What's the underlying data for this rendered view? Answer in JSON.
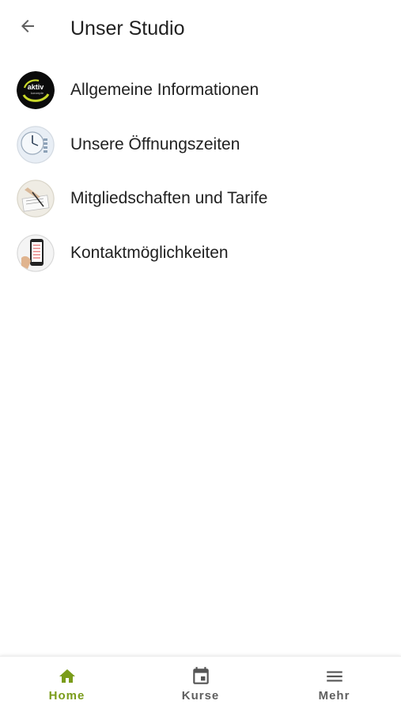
{
  "colors": {
    "accent": "#7a9c1a",
    "inactive": "#555555",
    "text": "#212121",
    "background": "#ffffff"
  },
  "header": {
    "back_icon": "arrow-back-icon",
    "title": "Unser Studio"
  },
  "menu": {
    "items": [
      {
        "label": "Allgemeine Informationen",
        "icon": "aktiv-konzepte-logo"
      },
      {
        "label": "Unsere Öffnungszeiten",
        "icon": "clock-photo"
      },
      {
        "label": "Mitgliedschaften und Tarife",
        "icon": "contract-photo"
      },
      {
        "label": "Kontaktmöglichkeiten",
        "icon": "phone-photo"
      }
    ]
  },
  "logo_text": {
    "word": "aktiv",
    "subword": "konzepte"
  },
  "bottom_nav": {
    "items": [
      {
        "label": "Home",
        "icon": "home-icon",
        "active": true
      },
      {
        "label": "Kurse",
        "icon": "calendar-icon",
        "active": false
      },
      {
        "label": "Mehr",
        "icon": "menu-icon",
        "active": false
      }
    ]
  }
}
